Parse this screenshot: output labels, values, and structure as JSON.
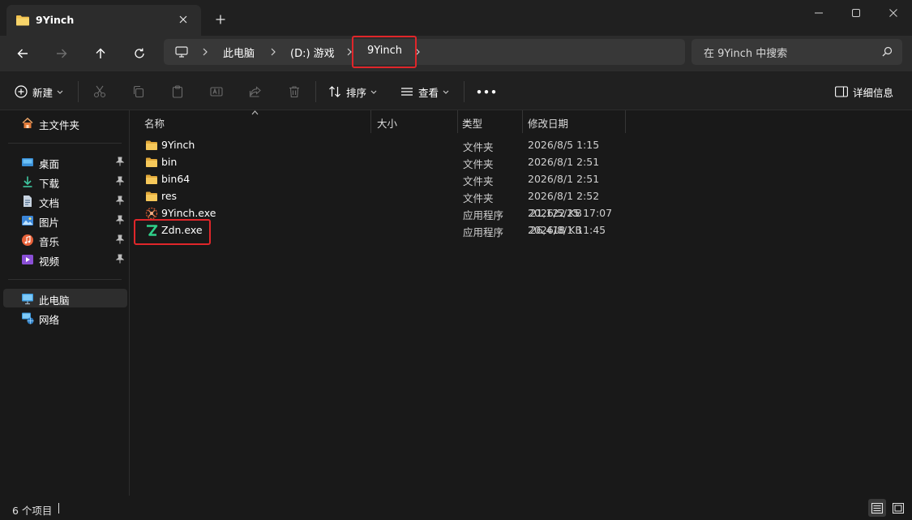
{
  "tab": {
    "title": "9Yinch"
  },
  "breadcrumb": {
    "items": [
      "此电脑",
      "(D:) 游戏",
      "9Yinch"
    ]
  },
  "search": {
    "placeholder": "在 9Yinch 中搜索"
  },
  "toolbar": {
    "new_label": "新建",
    "sort_label": "排序",
    "view_label": "查看",
    "more_label": "•••",
    "details_label": "详细信息"
  },
  "sidebar": {
    "home": "主文件夹",
    "quick_access": [
      {
        "label": "桌面",
        "icon": "desktop-icon"
      },
      {
        "label": "下载",
        "icon": "download-icon"
      },
      {
        "label": "文档",
        "icon": "document-icon"
      },
      {
        "label": "图片",
        "icon": "pictures-icon"
      },
      {
        "label": "音乐",
        "icon": "music-icon"
      },
      {
        "label": "视频",
        "icon": "video-icon"
      }
    ],
    "this_pc": "此电脑",
    "network": "网络"
  },
  "columns": {
    "name": "名称",
    "size": "大小",
    "type": "类型",
    "date": "修改日期"
  },
  "files": [
    {
      "name": "9Yinch",
      "size": "",
      "type": "文件夹",
      "date": "2026/8/5 1:15",
      "icon": "folder-icon"
    },
    {
      "name": "bin",
      "size": "",
      "type": "文件夹",
      "date": "2026/8/1 2:51",
      "icon": "folder-icon"
    },
    {
      "name": "bin64",
      "size": "",
      "type": "文件夹",
      "date": "2026/8/1 2:51",
      "icon": "folder-icon"
    },
    {
      "name": "res",
      "size": "",
      "type": "文件夹",
      "date": "2026/8/1 2:52",
      "icon": "folder-icon"
    },
    {
      "name": "9Yinch.exe",
      "size": "21,122 KB",
      "type": "应用程序",
      "date": "2026/5/25 17:07",
      "icon": "9yinch-app-icon"
    },
    {
      "name": "Zdn.exe",
      "size": "26,418 KB",
      "type": "应用程序",
      "date": "2026/8/1 11:45",
      "icon": "zdn-app-icon"
    }
  ],
  "status": {
    "item_count": "6 个项目"
  },
  "colors": {
    "highlight": "#e0262a",
    "folder": "#f2c14e",
    "zdn_accent": "#2fd08a"
  }
}
